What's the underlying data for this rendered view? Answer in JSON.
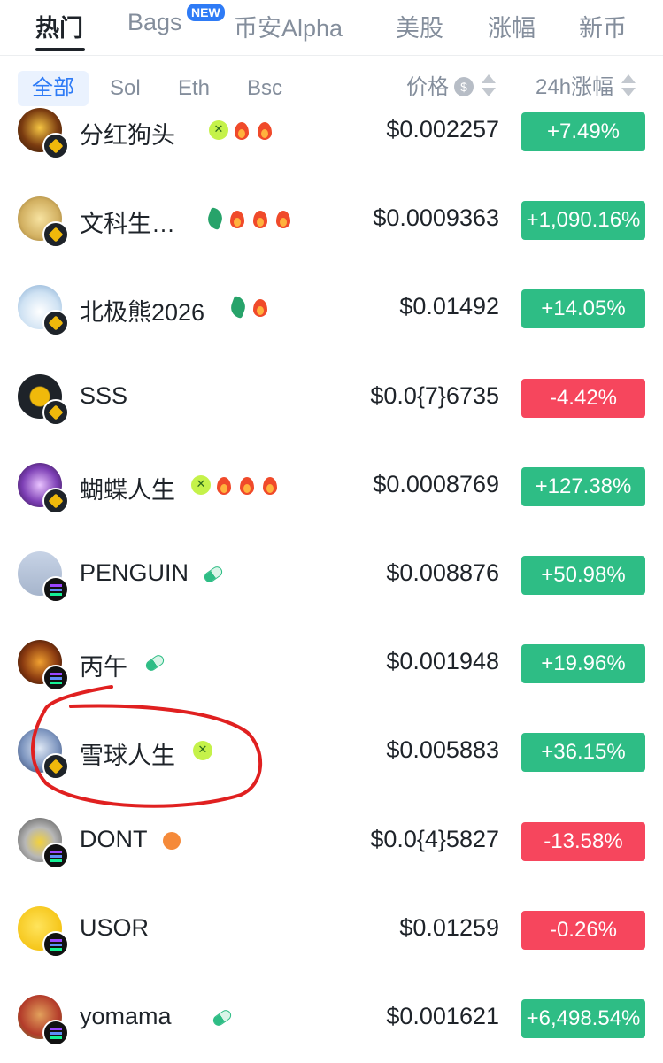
{
  "tabs": [
    {
      "label": "热门",
      "active": true
    },
    {
      "label": "Bags",
      "badge": "NEW"
    },
    {
      "label": "币安Alpha"
    },
    {
      "label": "美股"
    },
    {
      "label": "涨幅"
    },
    {
      "label": "新币"
    }
  ],
  "filters": [
    {
      "label": "全部",
      "active": true
    },
    {
      "label": "Sol"
    },
    {
      "label": "Eth"
    },
    {
      "label": "Bsc"
    }
  ],
  "sort": {
    "price_label": "价格",
    "price_currency_icon": "$",
    "change_label": "24h涨幅"
  },
  "colors": {
    "up": "#2ebd85",
    "down": "#f6465d",
    "accent": "#2e7bf6",
    "annotation": "#e02020"
  },
  "rows": [
    {
      "name": "分红狗头",
      "chain": "bsc",
      "tags": [
        "x-icon",
        "fire-icon",
        "fire-icon"
      ],
      "price": "$0.002257",
      "change": "+7.49%",
      "direction": "up"
    },
    {
      "name": "文科生…",
      "chain": "bsc",
      "tags": [
        "leaf-icon",
        "fire-icon",
        "fire-icon",
        "fire-icon"
      ],
      "price": "$0.0009363",
      "change": "+1,090.16%",
      "direction": "up"
    },
    {
      "name": "北极熊2026",
      "chain": "bsc",
      "tags": [
        "leaf-icon",
        "fire-icon"
      ],
      "price": "$0.01492",
      "change": "+14.05%",
      "direction": "up"
    },
    {
      "name": "SSS",
      "chain": "bsc",
      "tags": [],
      "price": "$0.0{7}6735",
      "change": "-4.42%",
      "direction": "down"
    },
    {
      "name": "蝴蝶人生",
      "chain": "bsc",
      "tags": [
        "x-icon",
        "fire-icon",
        "fire-icon",
        "fire-icon"
      ],
      "price": "$0.0008769",
      "change": "+127.38%",
      "direction": "up"
    },
    {
      "name": "PENGUIN",
      "chain": "sol",
      "tags": [
        "pill-icon"
      ],
      "price": "$0.008876",
      "change": "+50.98%",
      "direction": "up"
    },
    {
      "name": "丙午",
      "chain": "sol",
      "tags": [
        "pill-icon"
      ],
      "price": "$0.001948",
      "change": "+19.96%",
      "direction": "up"
    },
    {
      "name": "雪球人生",
      "chain": "bsc",
      "tags": [
        "x-icon"
      ],
      "price": "$0.005883",
      "change": "+36.15%",
      "direction": "up",
      "circled": true
    },
    {
      "name": "DONT",
      "chain": "sol",
      "tags": [
        "dog-icon"
      ],
      "price": "$0.0{4}5827",
      "change": "-13.58%",
      "direction": "down"
    },
    {
      "name": "USOR",
      "chain": "sol",
      "tags": [],
      "price": "$0.01259",
      "change": "-0.26%",
      "direction": "down"
    },
    {
      "name": "yomama",
      "chain": "sol",
      "tags": [
        "pill-icon"
      ],
      "price": "$0.001621",
      "change": "+6,498.54%",
      "direction": "up"
    }
  ]
}
